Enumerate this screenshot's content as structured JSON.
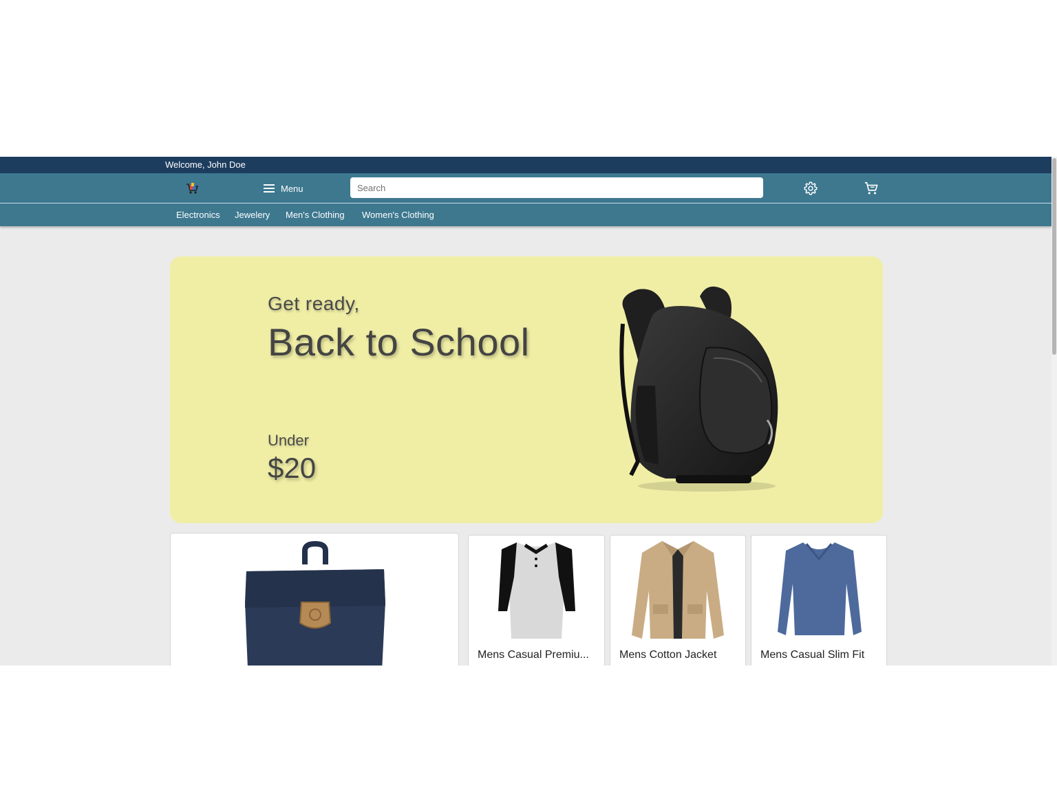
{
  "header": {
    "welcome": "Welcome, John Doe",
    "menu_label": "Menu",
    "search_placeholder": "Search"
  },
  "categories": [
    "Electronics",
    "Jewelery",
    "Men's Clothing",
    "Women's Clothing"
  ],
  "hero": {
    "line1": "Get ready,",
    "line2": "Back to School",
    "line3": "Under",
    "price": "$20"
  },
  "products": [
    {
      "title": ""
    },
    {
      "title": "Mens Casual Premiu..."
    },
    {
      "title": "Mens Cotton Jacket"
    },
    {
      "title": "Mens Casual Slim Fit"
    }
  ],
  "colors": {
    "welcome_bar": "#1d3d5f",
    "nav": "#3d788f",
    "hero_bg": "#f0eea5",
    "page_bg": "#ebebeb"
  },
  "icons": [
    "logo-icon",
    "menu-icon",
    "settings-icon",
    "cart-icon"
  ]
}
